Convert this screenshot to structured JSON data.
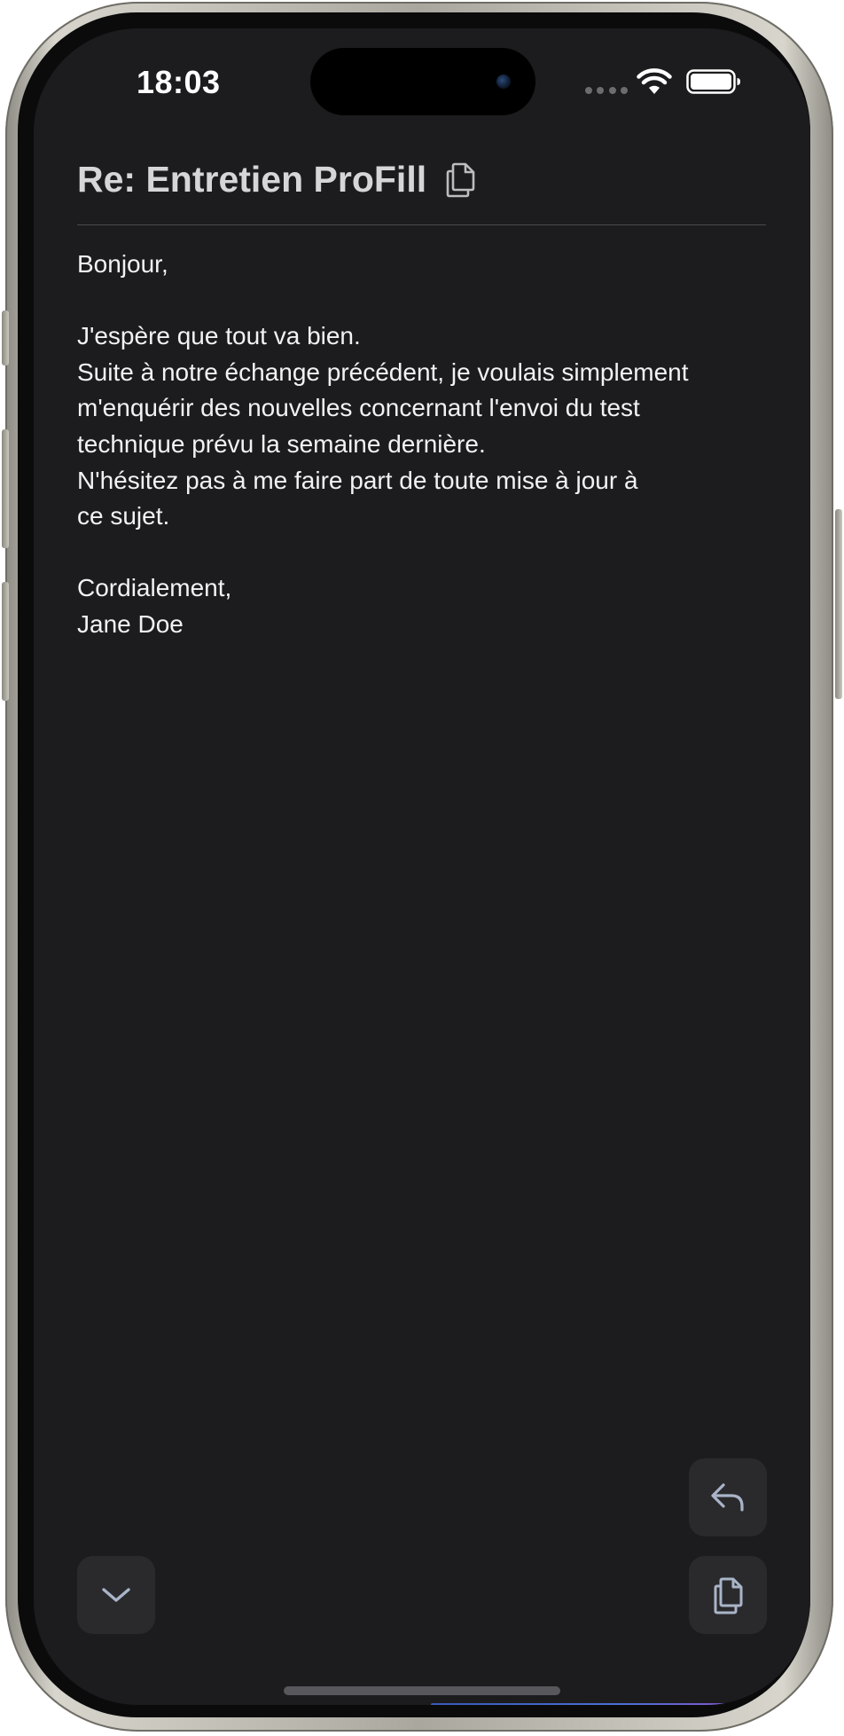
{
  "status_bar": {
    "time": "18:03"
  },
  "email": {
    "subject": "Re: Entretien ProFill",
    "body_lines": [
      "Bonjour,",
      "",
      "J'espère que tout va bien.",
      "Suite à notre échange précédent, je voulais simplement",
      "m'enquérir des nouvelles concernant l'envoi du test",
      "technique prévu la semaine dernière.",
      "N'hésitez pas à me faire part de toute mise à jour à",
      "ce sujet.",
      "",
      "Cordialement,",
      "Jane Doe"
    ]
  },
  "icons": {
    "title_copy": "copy-icon",
    "reply": "reply-arrow-icon",
    "copy": "copy-icon",
    "down": "chevron-down-icon",
    "wifi": "wifi-icon",
    "battery": "battery-icon"
  },
  "colors": {
    "background": "#1c1c1e",
    "button": "#2a2a2d",
    "icon": "#a9b4c8",
    "text": "#f2f2f4",
    "title": "#d6d6d8"
  }
}
